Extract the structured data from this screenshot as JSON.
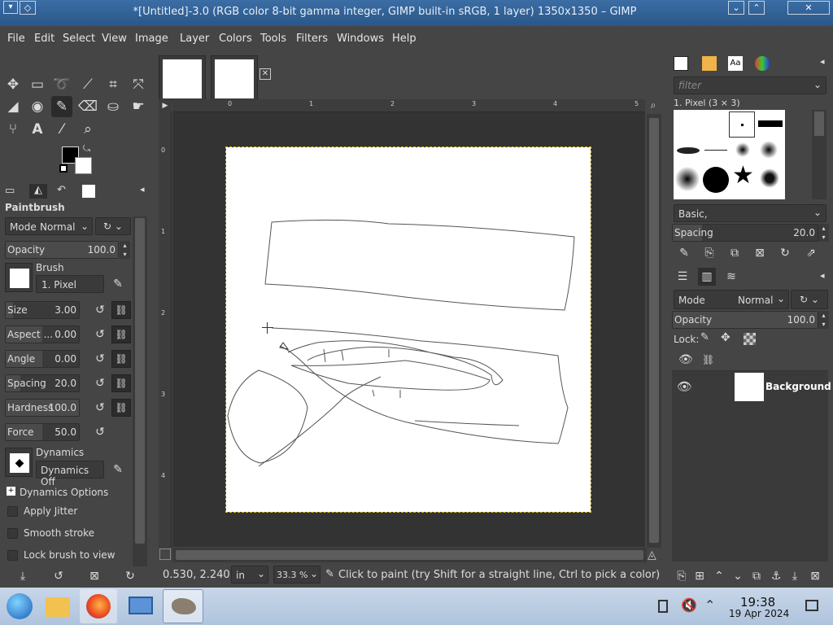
{
  "window": {
    "title": "*[Untitled]-3.0 (RGB color 8-bit gamma integer, GIMP built-in sRGB, 1 layer) 1350x1350 – GIMP"
  },
  "menu": [
    "File",
    "Edit",
    "Select",
    "View",
    "Image",
    "Layer",
    "Colors",
    "Tools",
    "Filters",
    "Windows",
    "Help"
  ],
  "tool_options": {
    "title": "Paintbrush",
    "mode_label": "Mode",
    "mode_value": "Normal",
    "opacity": {
      "label": "Opacity",
      "value": "100.0"
    },
    "brush_label": "Brush",
    "brush_value": "1. Pixel",
    "size": {
      "label": "Size",
      "value": "3.00"
    },
    "aspect": {
      "label": "Aspect ...",
      "value": "0.00"
    },
    "angle": {
      "label": "Angle",
      "value": "0.00"
    },
    "spacing": {
      "label": "Spacing",
      "value": "20.0"
    },
    "hardness": {
      "label": "Hardness",
      "value": "100.0"
    },
    "force": {
      "label": "Force",
      "value": "50.0"
    },
    "dynamics_label": "Dynamics",
    "dynamics_value": "Dynamics Off",
    "dynamics_options": "Dynamics Options",
    "apply_jitter": "Apply Jitter",
    "smooth_stroke": "Smooth stroke",
    "lock_brush": "Lock brush to view"
  },
  "rulers": {
    "h": [
      "0",
      "1",
      "2",
      "3",
      "4",
      "5"
    ],
    "v": [
      "0",
      "1",
      "2",
      "3",
      "4"
    ]
  },
  "status": {
    "coords": "0.530, 2.240",
    "unit": "in",
    "zoom": "33.3 %",
    "message": "Click to paint (try Shift for a straight line, Ctrl to pick a color)"
  },
  "brushes": {
    "filter_placeholder": "filter",
    "selected": "1. Pixel (3 × 3)",
    "preset": "Basic,",
    "spacing_label": "Spacing",
    "spacing_value": "20.0"
  },
  "layers": {
    "mode_label": "Mode",
    "mode_value": "Normal",
    "opacity_label": "Opacity",
    "opacity_value": "100.0",
    "lock_label": "Lock:",
    "layer_name": "Background"
  },
  "taskbar": {
    "time": "19:38",
    "date": "19 Apr 2024"
  }
}
